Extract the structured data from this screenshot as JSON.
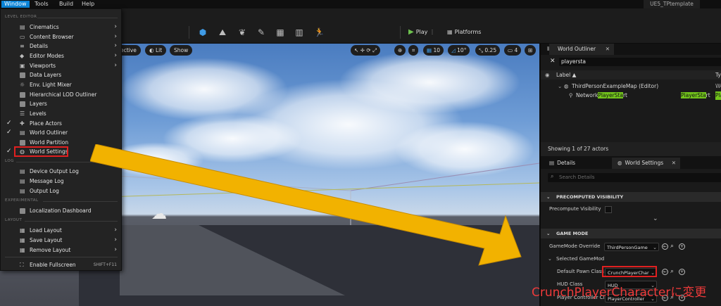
{
  "menubar": {
    "items": [
      {
        "label": "Window",
        "active": true
      },
      {
        "label": "Tools",
        "active": false
      },
      {
        "label": "Build",
        "active": false
      },
      {
        "label": "Help",
        "active": false
      }
    ],
    "project_tab": "UE5_TPtemplate"
  },
  "toolbar": {
    "play_label": "Play",
    "platforms_label": "Platforms"
  },
  "viewport": {
    "view_mode_label": "ective",
    "lit_label": "Lit",
    "show_label": "Show",
    "grid_value": "10",
    "angle_value": "10°",
    "scale_value": "0.25",
    "camera_speed": "4"
  },
  "window_menu": {
    "sections": [
      {
        "header": "LEVEL EDITOR",
        "items": [
          {
            "label": "Cinematics",
            "checked": false,
            "submenu": true,
            "icon": "film-icon"
          },
          {
            "label": "Content Browser",
            "checked": false,
            "submenu": true,
            "icon": "folder-icon"
          },
          {
            "label": "Details",
            "checked": false,
            "submenu": true,
            "icon": "list-icon"
          },
          {
            "label": "Editor Modes",
            "checked": false,
            "submenu": true,
            "icon": "modes-icon"
          },
          {
            "label": "Viewports",
            "checked": false,
            "submenu": true,
            "icon": "viewport-icon"
          },
          {
            "label": "Data Layers",
            "checked": false,
            "submenu": false,
            "icon": "layers-icon"
          },
          {
            "label": "Env. Light Mixer",
            "checked": false,
            "submenu": false,
            "icon": "sun-icon"
          },
          {
            "label": "Hierarchical LOD Outliner",
            "checked": false,
            "submenu": false,
            "icon": "hlod-icon"
          },
          {
            "label": "Layers",
            "checked": false,
            "submenu": false,
            "icon": "layers-icon"
          },
          {
            "label": "Levels",
            "checked": false,
            "submenu": false,
            "icon": "levels-icon"
          },
          {
            "label": "Place Actors",
            "checked": true,
            "submenu": false,
            "icon": "place-actors-icon"
          },
          {
            "label": "World Outliner",
            "checked": true,
            "submenu": false,
            "icon": "outliner-icon"
          },
          {
            "label": "World Partition",
            "checked": false,
            "submenu": false,
            "icon": "partition-icon"
          },
          {
            "label": "World Settings",
            "checked": true,
            "submenu": false,
            "icon": "globe-icon"
          }
        ]
      },
      {
        "header": "LOG",
        "items": [
          {
            "label": "Device Output Log",
            "checked": false,
            "submenu": false,
            "icon": "log-icon"
          },
          {
            "label": "Message Log",
            "checked": false,
            "submenu": false,
            "icon": "log-icon"
          },
          {
            "label": "Output Log",
            "checked": false,
            "submenu": false,
            "icon": "log-icon"
          }
        ]
      },
      {
        "header": "EXPERIMENTAL",
        "items": [
          {
            "label": "Localization Dashboard",
            "checked": false,
            "submenu": false,
            "icon": "localization-icon"
          }
        ]
      },
      {
        "header": "LAYOUT",
        "items": [
          {
            "label": "Load Layout",
            "checked": false,
            "submenu": true,
            "icon": "layout-icon"
          },
          {
            "label": "Save Layout",
            "checked": false,
            "submenu": true,
            "icon": "layout-icon"
          },
          {
            "label": "Remove Layout",
            "checked": false,
            "submenu": true,
            "icon": "layout-icon"
          }
        ]
      }
    ],
    "fullscreen_label": "Enable Fullscreen",
    "fullscreen_shortcut": "SHIFT+F11"
  },
  "outliner": {
    "tab_label": "World Outliner",
    "search_value": "playersta",
    "col_label": "Label ▲",
    "col_type": "Ty",
    "rows": {
      "map_label": "ThirdPersonExampleMap (Editor)",
      "map_type": "Wo",
      "actor_prefix": "Network",
      "actor_match": "PlayerSta",
      "actor_suffix": "rt",
      "actor_type_match": "PlayerSta",
      "actor_type_suffix": "rt",
      "actor_type2": "Pla"
    },
    "status": "Showing 1 of 27 actors"
  },
  "details": {
    "tab_details": "Details",
    "tab_world_settings": "World Settings",
    "search_placeholder": "Search Details",
    "cat_precomputed": "PRECOMPUTED VISIBILITY",
    "precompute_label": "Precompute Visibility",
    "cat_game_mode": "GAME MODE",
    "gamemode_override_label": "GameMode Override",
    "gamemode_override_value": "ThirdPersonGame",
    "selected_gamemode_label": "Selected GameMod",
    "default_pawn_label": "Default Pawn Class",
    "default_pawn_value": "CrunchPlayerChar",
    "hud_label": "HUD Class",
    "hud_value": "HUD",
    "player_controller_label": "Player Controller Cl",
    "player_controller_value": "PlayerController"
  },
  "annotation": "CrunchPlayerCharacterに変更",
  "colors": {
    "highlight_red": "#e02020",
    "arrow_yellow": "#f2b200",
    "search_match_green": "#73c51c",
    "menu_active_blue": "#0a84d8"
  }
}
